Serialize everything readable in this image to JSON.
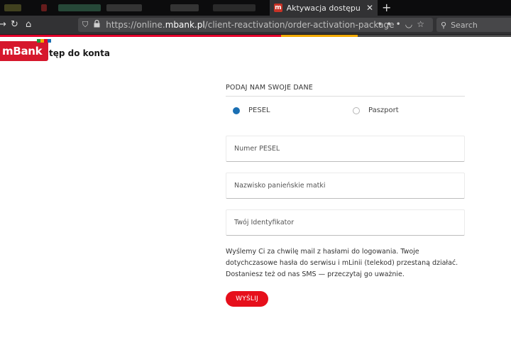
{
  "browser": {
    "active_tab": {
      "favicon": "m",
      "title": "Aktywacja dostępu do konta"
    },
    "url": {
      "prefix": "https://online.",
      "domain": "mbank.pl",
      "path": "/client-reactivation/order-activation-package"
    },
    "search_placeholder": "Search",
    "icons": {
      "back": "back-arrow-icon",
      "reload": "reload-icon",
      "home": "home-icon",
      "shield": "shield-icon",
      "lock": "lock-icon",
      "more": "more-dots-icon",
      "pocket": "pocket-icon",
      "bookmark": "star-icon",
      "search": "search-icon",
      "close_tab": "close-icon",
      "new_tab": "plus-icon"
    }
  },
  "brand": {
    "logo_text": "mBank",
    "bar_colors": [
      "#1a9b3c",
      "#f2a900",
      "#e4002b",
      "#1a6fb3"
    ]
  },
  "page": {
    "title": "tęp do konta"
  },
  "form": {
    "section_heading": "PODAJ NAM SWOJE DANE",
    "radio_options": [
      {
        "label": "PESEL",
        "checked": true
      },
      {
        "label": "Paszport",
        "checked": false
      }
    ],
    "fields": {
      "pesel_placeholder": "Numer PESEL",
      "maiden_name_placeholder": "Nazwisko panieńskie matki",
      "identifier_placeholder": "Twój Identyfikator"
    },
    "info_text": "Wyślemy Ci za chwilę mail z hasłami do logowania. Twoje dotychczasowe hasła do serwisu i mLinii (telekod) przestaną działać. Dostaniesz też od nas SMS — przeczytaj go uważnie.",
    "submit_label": "WYŚLIJ"
  },
  "colors": {
    "brand_red": "#e60f1b",
    "radio_blue": "#1a6fb3"
  }
}
